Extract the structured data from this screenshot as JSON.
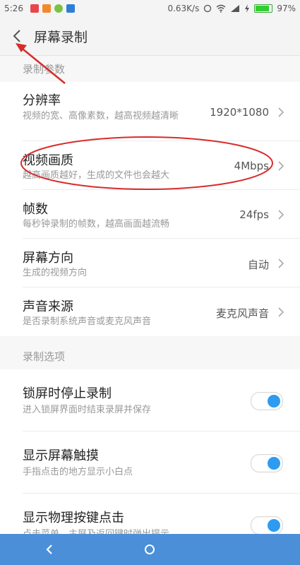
{
  "status_bar": {
    "time": "5:26",
    "speed": "0.63K/s",
    "battery": "97%",
    "battery_level": 0.97
  },
  "app_bar": {
    "title": "屏幕录制",
    "back_icon": "chevron-left-icon"
  },
  "sections": [
    {
      "header": "录制参数",
      "rows": [
        {
          "title": "分辨率",
          "subtitle": "视频的宽、高像素数，越高视频越清晰",
          "value": "1920*1080"
        },
        {
          "title": "视频画质",
          "subtitle": "越高画质越好，生成的文件也会越大",
          "value": "4Mbps"
        },
        {
          "title": "帧数",
          "subtitle": "每秒钟录制的帧数，越高画面越流畅",
          "value": "24fps"
        },
        {
          "title": "屏幕方向",
          "subtitle": "生成的视频方向",
          "value": "自动"
        },
        {
          "title": "声音来源",
          "subtitle": "是否录制系统声音或麦克风声音",
          "value": "麦克风声音"
        }
      ]
    },
    {
      "header": "录制选项",
      "rows": [
        {
          "title": "锁屏时停止录制",
          "subtitle": "进入锁屏界面时结束录屏并保存",
          "on": true
        },
        {
          "title": "显示屏幕触摸",
          "subtitle": "手指点击的地方显示小白点",
          "on": true
        },
        {
          "title": "显示物理按键点击",
          "subtitle": "点击菜单、主屏及返回键时弹出提示",
          "on": true
        }
      ]
    }
  ],
  "colors": {
    "accent": "#2d9bf0",
    "nav_bar": "#4a8fd8",
    "annotation": "#d92b2b"
  },
  "nav": {
    "back_icon": "nav-back-icon",
    "home_icon": "nav-home-icon"
  }
}
